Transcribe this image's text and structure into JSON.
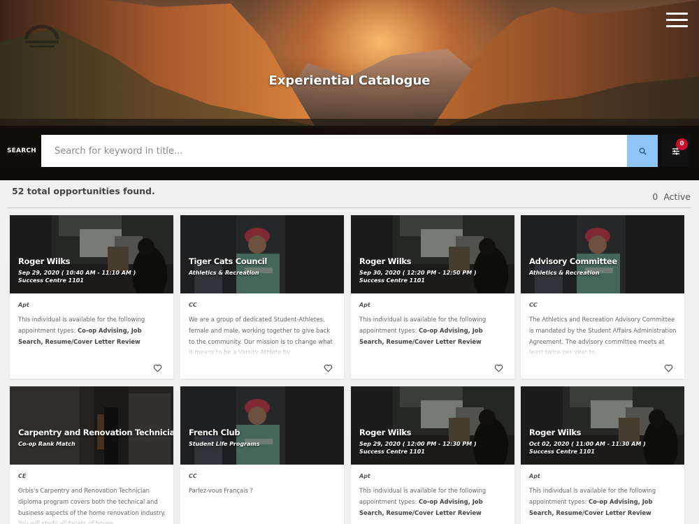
{
  "header": {
    "title": "Experiential Catalogue",
    "menu_icon": "hamburger-menu-icon"
  },
  "search": {
    "label": "SEARCH",
    "placeholder": "Search for keyword in title...",
    "value": "",
    "button_icon": "search-icon",
    "filter_icon": "filter-sliders-icon",
    "filter_count": "0",
    "button_color": "#8ec5f7",
    "badge_color": "#c8102e"
  },
  "results": {
    "summary": "52 total opportunities found.",
    "active_count": "0",
    "active_label": "Active"
  },
  "cards": [
    {
      "title": "Roger Wilks",
      "sub1": "Sep 29, 2020 ( 10:40 AM - 11:10 AM )",
      "sub2": "Success Centre 1101",
      "type": "Apt",
      "desc_plain": "This individual is available for the following appointment types: ",
      "desc_bold": "Co-op Advising, Job Search, Resume/Cover Letter Review",
      "image": "meeting",
      "fade": false
    },
    {
      "title": "Tiger Cats Council",
      "sub1": "Athletics & Recreation",
      "sub2": "",
      "type": "CC",
      "desc_plain": "We are a group of dedicated Student-Athletes, female and male, working together to give back to the community. Our mission is to change what it means to be a Varsity Athlete by",
      "desc_bold": "",
      "image": "volunteer",
      "fade": true
    },
    {
      "title": "Roger Wilks",
      "sub1": "Sep 30, 2020 ( 12:20 PM - 12:50 PM )",
      "sub2": "Success Centre 1101",
      "type": "Apt",
      "desc_plain": "This individual is available for the following appointment types: ",
      "desc_bold": "Co-op Advising, Job Search, Resume/Cover Letter Review",
      "image": "meeting",
      "fade": false
    },
    {
      "title": "Advisory Committee",
      "sub1": "Athletics & Recreation",
      "sub2": "",
      "type": "CC",
      "desc_plain": "The Athletics and Recreation Advisory Committee is mandated by the Student Affairs Administration Agreement. The advisory committee meets at least twice per year to",
      "desc_bold": "",
      "image": "volunteer",
      "fade": true
    },
    {
      "title": "Carpentry and Renovation Technician",
      "sub1": "Co-op Rank Match",
      "sub2": "",
      "type": "CE",
      "desc_plain": "Orbis's Carpentry and Renovation Technician diploma program covers both the technical and business aspects of the home renovation industry. You will study all facets of house",
      "desc_bold": "",
      "image": "workshop",
      "fade": true
    },
    {
      "title": "French Club",
      "sub1": "Student Life Programs",
      "sub2": "",
      "type": "CC",
      "desc_plain": "Parlez-vous Français ?",
      "desc_bold": "",
      "image": "volunteer",
      "fade": false
    },
    {
      "title": "Roger Wilks",
      "sub1": "Sep 29, 2020 ( 12:00 PM - 12:30 PM )",
      "sub2": "Success Centre 1101",
      "type": "Apt",
      "desc_plain": "This individual is available for the following appointment types: ",
      "desc_bold": "Co-op Advising, Job Search, Resume/Cover Letter Review",
      "image": "meeting",
      "fade": false
    },
    {
      "title": "Roger Wilks",
      "sub1": "Oct 02, 2020 ( 11:00 AM - 11:30 AM )",
      "sub2": "Success Centre 1101",
      "type": "Apt",
      "desc_plain": "This individual is available for the following appointment types: ",
      "desc_bold": "Co-op Advising, Job Search, Resume/Cover Letter Review",
      "image": "meeting",
      "fade": false
    }
  ],
  "card_heart_icon": "heart-outline-icon"
}
